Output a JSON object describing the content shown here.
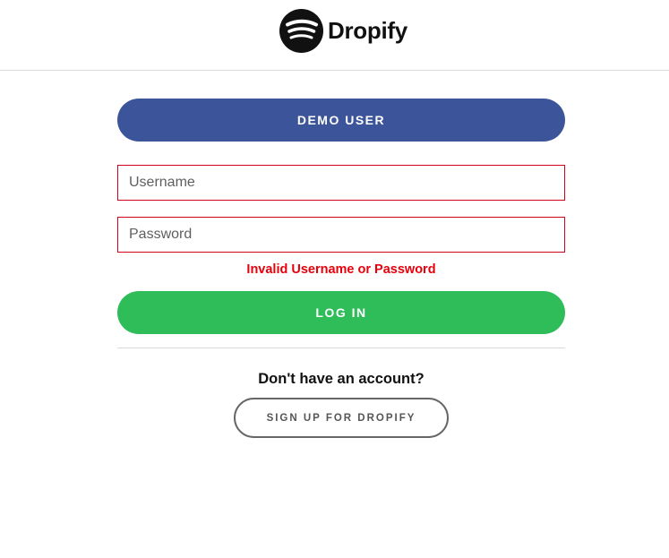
{
  "header": {
    "brand_name": "Dropify",
    "logo_icon": "dropify-logo-icon"
  },
  "form": {
    "demo_button_label": "DEMO USER",
    "username": {
      "value": "",
      "placeholder": "Username"
    },
    "password": {
      "value": "",
      "placeholder": "Password"
    },
    "error_message": "Invalid Username or Password",
    "login_button_label": "LOG IN"
  },
  "signup": {
    "prompt": "Don't have an account?",
    "button_label": "SIGN UP FOR DROPIFY"
  },
  "colors": {
    "demo_button": "#3c5499",
    "login_button": "#2ebd59",
    "error": "#e8000b",
    "field_border_error": "#d0021b"
  }
}
